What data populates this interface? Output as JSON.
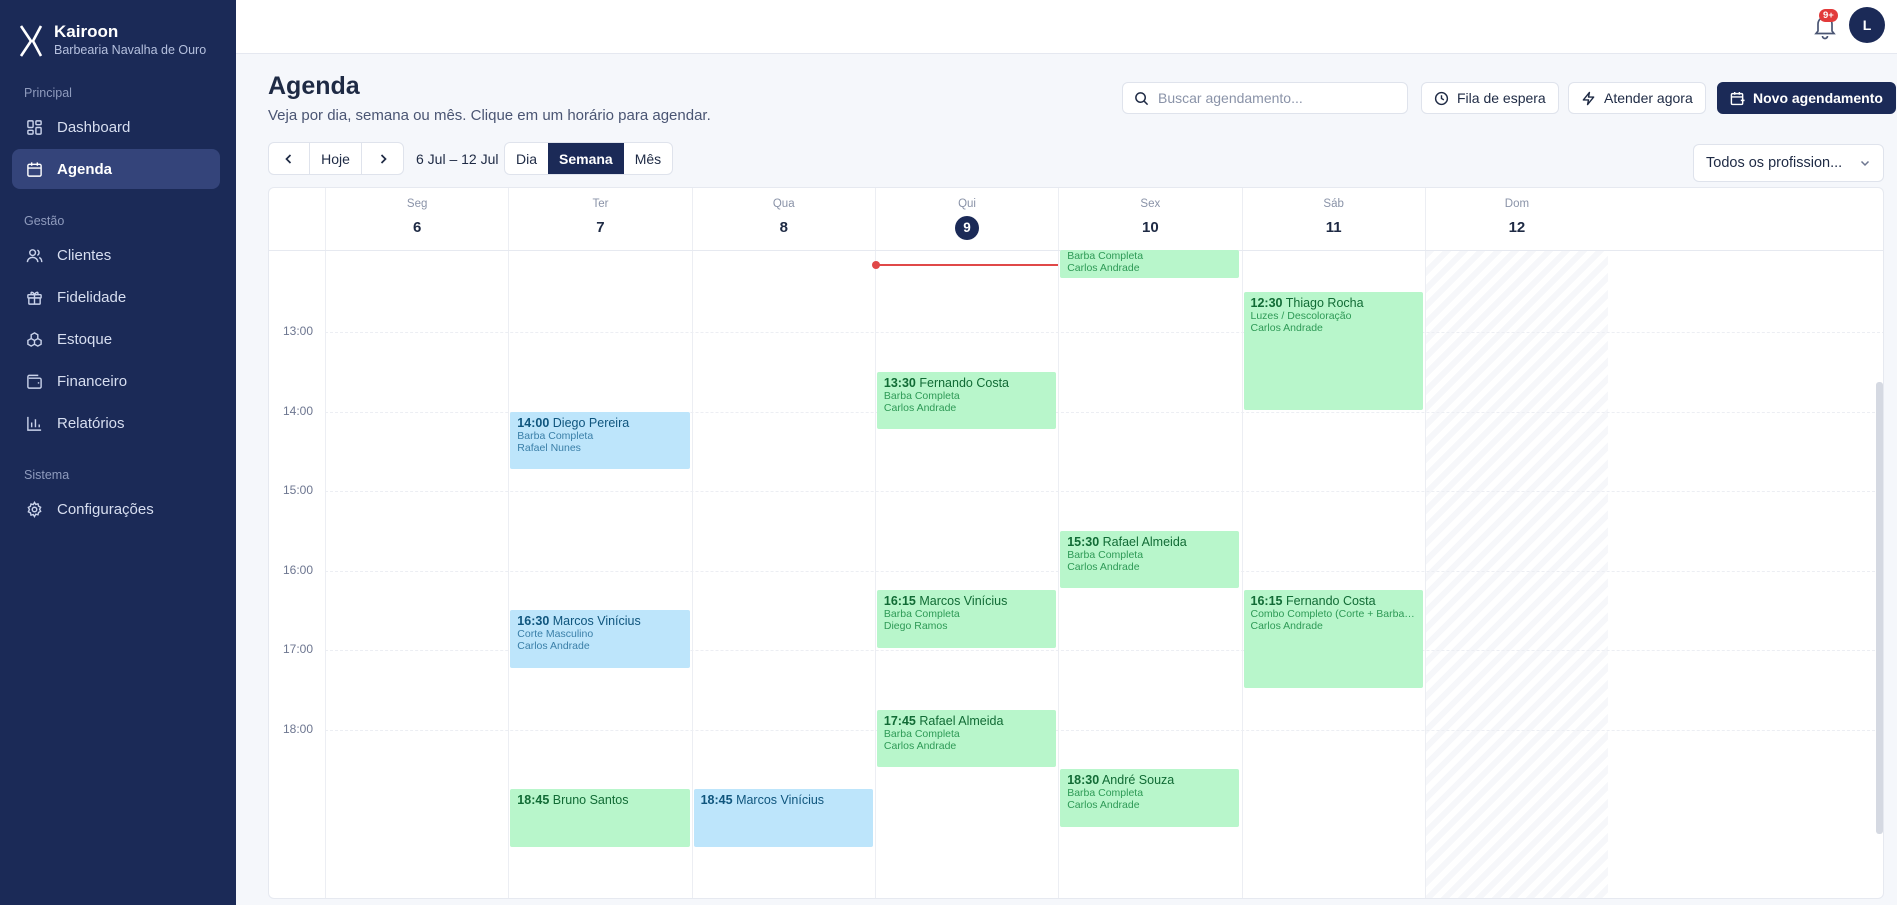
{
  "sidebar": {
    "brand_name": "Kairoon",
    "brand_sub": "Barbearia Navalha de Ouro",
    "sections": {
      "principal": "Principal",
      "gestao": "Gestão",
      "sistema": "Sistema"
    },
    "items": {
      "dashboard": "Dashboard",
      "agenda": "Agenda",
      "clientes": "Clientes",
      "fidelidade": "Fidelidade",
      "estoque": "Estoque",
      "financeiro": "Financeiro",
      "relatorios": "Relatórios",
      "configuracoes": "Configurações"
    },
    "active_item": "agenda"
  },
  "topbar": {
    "notification_badge": "9+",
    "avatar_initial": "L"
  },
  "header": {
    "title": "Agenda",
    "subtitle": "Veja por dia, semana ou mês. Clique em um horário para agendar.",
    "search_placeholder": "Buscar agendamento...",
    "waitlist_label": "Fila de espera",
    "attend_now_label": "Atender agora",
    "new_appointment_label": "Novo agendamento"
  },
  "toolbar": {
    "today_label": "Hoje",
    "range_label": "6 Jul – 12 Jul",
    "views": {
      "day": "Dia",
      "week": "Semana",
      "month": "Mês"
    },
    "active_view": "week",
    "professional_filter": "Todos os profission..."
  },
  "calendar": {
    "days": [
      {
        "name": "Seg",
        "num": "6"
      },
      {
        "name": "Ter",
        "num": "7"
      },
      {
        "name": "Qua",
        "num": "8"
      },
      {
        "name": "Qui",
        "num": "9",
        "today": true
      },
      {
        "name": "Sex",
        "num": "10"
      },
      {
        "name": "Sáb",
        "num": "11"
      },
      {
        "name": "Dom",
        "num": "12",
        "closed": true
      }
    ],
    "hours": [
      "13:00",
      "14:00",
      "15:00",
      "16:00",
      "17:00",
      "18:00"
    ],
    "current_time_day": 3,
    "events": [
      {
        "day": 4,
        "time": "",
        "client": "",
        "service": "Barba Completa",
        "professional": "Carlos Andrade",
        "color": "green",
        "partial_top": true
      },
      {
        "day": 5,
        "time": "12:30",
        "client": "Thiago Rocha",
        "service": "Luzes / Descoloração",
        "professional": "Carlos Andrade",
        "color": "green"
      },
      {
        "day": 3,
        "time": "13:30",
        "client": "Fernando Costa",
        "service": "Barba Completa",
        "professional": "Carlos Andrade",
        "color": "green"
      },
      {
        "day": 1,
        "time": "14:00",
        "client": "Diego Pereira",
        "service": "Barba Completa",
        "professional": "Rafael Nunes",
        "color": "blue"
      },
      {
        "day": 4,
        "time": "15:30",
        "client": "Rafael Almeida",
        "service": "Barba Completa",
        "professional": "Carlos Andrade",
        "color": "green"
      },
      {
        "day": 3,
        "time": "16:15",
        "client": "Marcos Vinícius",
        "service": "Barba Completa",
        "professional": "Diego Ramos",
        "color": "green"
      },
      {
        "day": 5,
        "time": "16:15",
        "client": "Fernando Costa",
        "service": "Combo Completo (Corte + Barba + Sobr...",
        "professional": "Carlos Andrade",
        "color": "green"
      },
      {
        "day": 1,
        "time": "16:30",
        "client": "Marcos Vinícius",
        "service": "Corte Masculino",
        "professional": "Carlos Andrade",
        "color": "blue"
      },
      {
        "day": 3,
        "time": "17:45",
        "client": "Rafael Almeida",
        "service": "Barba Completa",
        "professional": "Carlos Andrade",
        "color": "green"
      },
      {
        "day": 4,
        "time": "18:30",
        "client": "André Souza",
        "service": "Barba Completa",
        "professional": "Carlos Andrade",
        "color": "green"
      },
      {
        "day": 1,
        "time": "18:45",
        "client": "Bruno Santos",
        "service": "",
        "professional": "",
        "color": "green"
      },
      {
        "day": 2,
        "time": "18:45",
        "client": "Marcos Vinícius",
        "service": "",
        "professional": "",
        "color": "blue"
      }
    ]
  }
}
